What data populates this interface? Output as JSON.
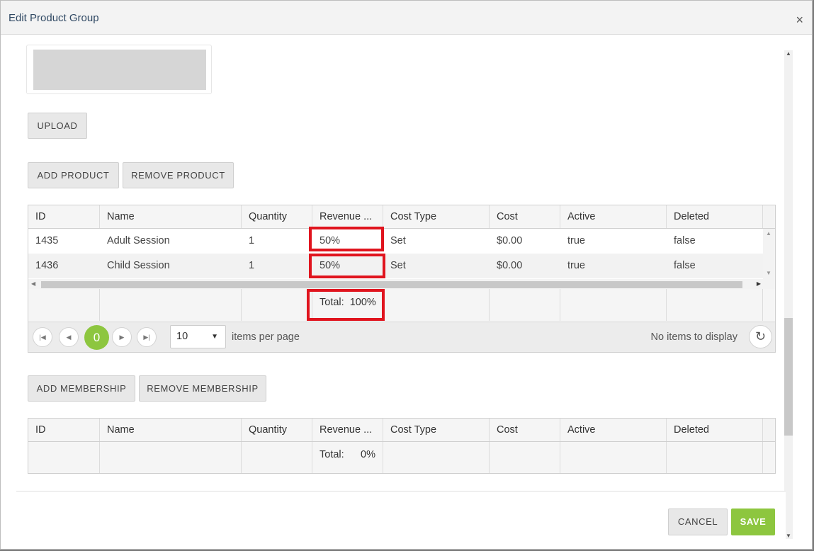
{
  "dialog": {
    "title": "Edit Product Group",
    "close_glyph": "×"
  },
  "image": {
    "upload_label": "UPLOAD"
  },
  "products": {
    "add_label": "ADD PRODUCT",
    "remove_label": "REMOVE PRODUCT",
    "columns": [
      "ID",
      "Name",
      "Quantity",
      "Revenue ...",
      "Cost Type",
      "Cost",
      "Active",
      "Deleted"
    ],
    "rows": [
      [
        "1435",
        "Adult Session",
        "1",
        "50%",
        "Set",
        "$0.00",
        "true",
        "false"
      ],
      [
        "1436",
        "Child Session",
        "1",
        "50%",
        "Set",
        "$0.00",
        "true",
        "false"
      ]
    ],
    "total_label": "Total:",
    "total_value": "100%",
    "pager": {
      "current_page": "0",
      "page_size": "10",
      "items_per_page_label": "items per page",
      "status": "No items to display"
    }
  },
  "memberships": {
    "add_label": "ADD MEMBERSHIP",
    "remove_label": "REMOVE MEMBERSHIP",
    "columns": [
      "ID",
      "Name",
      "Quantity",
      "Revenue ...",
      "Cost Type",
      "Cost",
      "Active",
      "Deleted"
    ],
    "total_label": "Total:",
    "total_value": "0%"
  },
  "actions": {
    "cancel_label": "CANCEL",
    "save_label": "SAVE"
  },
  "colors": {
    "accent": "#8dc63f",
    "highlight": "#e0141e",
    "title": "#2f4863"
  }
}
